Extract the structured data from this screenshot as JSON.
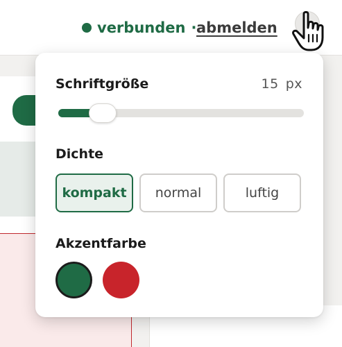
{
  "header": {
    "status_label": "verbunden",
    "separator": "·",
    "logout_label": "abmelden",
    "status_color": "#1f6b45"
  },
  "settings_popover": {
    "font_size": {
      "label": "Schriftgröße",
      "value": "15",
      "unit": "px",
      "slider_fraction": 0.18
    },
    "density": {
      "label": "Dichte",
      "options": [
        "kompakt",
        "normal",
        "luftig"
      ],
      "selected": "kompakt"
    },
    "accent_color": {
      "label": "Akzentfarbe",
      "swatches": [
        {
          "color": "#1f6b45",
          "selected": true
        },
        {
          "color": "#c8242b",
          "selected": false
        }
      ]
    }
  },
  "icons": [
    "status-dot-icon",
    "settings-trigger-icon",
    "hand-cursor-icon"
  ]
}
